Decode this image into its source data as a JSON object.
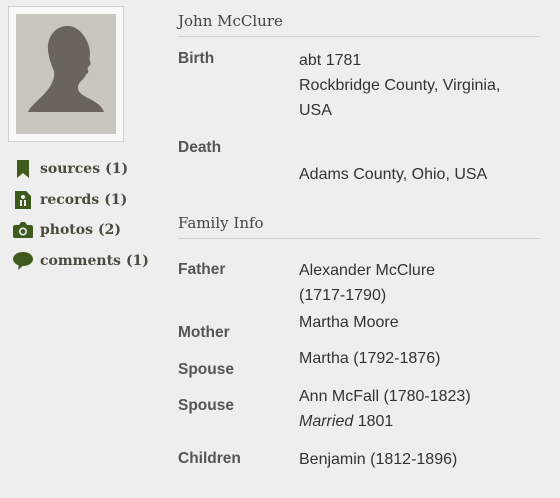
{
  "person": {
    "name": "John McClure"
  },
  "colors": {
    "icon": "#3f5a1d",
    "photo_bg": "#c9c5bf",
    "silhouette": "#6b645c"
  },
  "sidebar": {
    "links": [
      {
        "label": "sources",
        "count": "(1)",
        "icon": "bookmark-icon"
      },
      {
        "label": "records",
        "count": "(1)",
        "icon": "record-icon"
      },
      {
        "label": "photos",
        "count": "(2)",
        "icon": "camera-icon"
      },
      {
        "label": "comments",
        "count": "(1)",
        "icon": "speech-bubble-icon"
      }
    ]
  },
  "vitals": {
    "birth": {
      "label": "Birth",
      "date": "abt 1781",
      "place_line1": "Rockbridge County, Virginia,",
      "place_line2": "USA"
    },
    "death": {
      "label": "Death",
      "place": "Adams County, Ohio, USA"
    }
  },
  "family": {
    "title": "Family Info",
    "father": {
      "label": "Father",
      "name": "Alexander McClure",
      "years": "(1717-1790)"
    },
    "mother": {
      "label": "Mother",
      "name": "Martha Moore"
    },
    "spouse1": {
      "label": "Spouse",
      "name": "Martha (1792-1876)"
    },
    "spouse2": {
      "label": "Spouse",
      "name": "Ann McFall (1780-1823)",
      "married_word": "Married",
      "married_year": "1801"
    },
    "children": {
      "label": "Children",
      "name": "Benjamin (1812-1896)"
    }
  }
}
